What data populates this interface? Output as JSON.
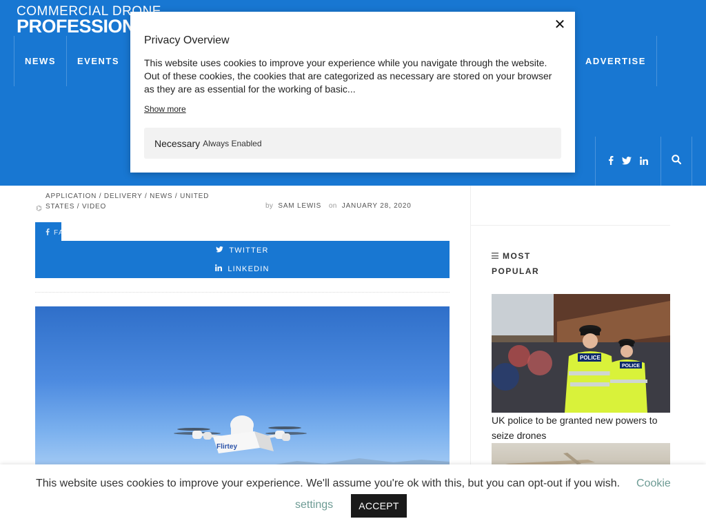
{
  "header": {
    "logo": {
      "line1": "COMMERCIAL DRONE",
      "line2": "PROFESSIONAL"
    },
    "nav_left": [
      "NEWS",
      "EVENTS"
    ],
    "nav_right": [
      "ADVERTISE"
    ],
    "social_icons": [
      "facebook-icon",
      "twitter-icon",
      "linkedin-icon"
    ],
    "search_icon": "search-icon",
    "brand_color": "#1877d2"
  },
  "article": {
    "categories_line1": "APPLICATION / DELIVERY / NEWS / UNITED",
    "categories_line2": "STATES / VIDEO",
    "by_label": "by",
    "author": "SAM LEWIS",
    "on_label": "on",
    "date": "JANUARY 28, 2020",
    "share": {
      "facebook": "FACEBOOK",
      "twitter": "TWITTER",
      "linkedin": "LINKEDIN"
    },
    "hero_drone_brand": "Flirtey"
  },
  "sidebar": {
    "most_popular_line1": "MOST",
    "most_popular_line2": "POPULAR",
    "posts": [
      {
        "title": "UK police to be granted new powers to seize drones",
        "image_text": "POLICE"
      }
    ]
  },
  "privacy_modal": {
    "title": "Privacy Overview",
    "body": "This website uses cookies to improve your experience while you navigate through the website. Out of these cookies, the cookies that are categorized as necessary are stored on your browser as they are as essential for the working of basic...",
    "show_more": "Show more",
    "necessary_label": "Necessary",
    "necessary_state": "Always Enabled",
    "close_symbol": "✕"
  },
  "cookie_bar": {
    "message": "This website uses cookies to improve your experience. We'll assume you're ok with this, but you can opt-out if you wish.",
    "settings_part1": "Cookie",
    "settings_part2": "settings",
    "accept_label": "ACCEPT",
    "link_color": "#6d9b94"
  }
}
